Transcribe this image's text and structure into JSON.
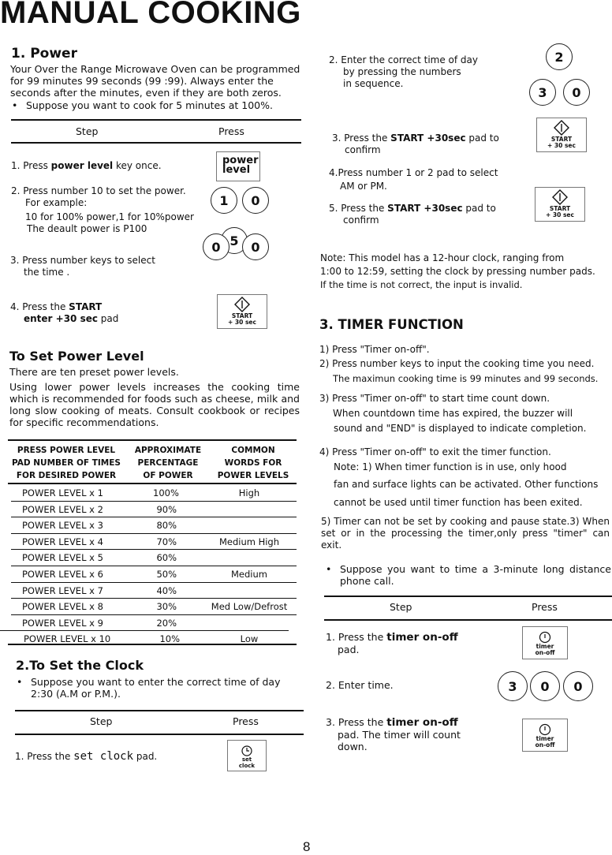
{
  "page_title": "MANUAL COOKING",
  "page_number": "8",
  "power": {
    "heading": "1. Power",
    "intro": "Your Over the Range Microwave Oven can be programmed for 99 minutes 99 seconds (99 :99). Always enter the seconds after the minutes, even if they are both zeros.",
    "bullet": "Suppose you want to cook for 5 minutes at 100%.",
    "table_headers": {
      "step": "Step",
      "press": "Press"
    },
    "steps": [
      {
        "pre": "1. Press ",
        "bold": "power level",
        "post": " key once."
      },
      {
        "line1": "2. Press number 10 to set the power.",
        "line2": "For example:",
        "line3": "10 for 100% power,1 for 10%power",
        "line4": "The deault power is P100"
      },
      {
        "line1": "3. Press number keys to select",
        "line2": "the time ."
      },
      {
        "pre": "4. Press the ",
        "bold1": "START",
        "bold2": "enter +30 sec",
        "post": " pad"
      }
    ],
    "keys": {
      "power_level": [
        "power",
        "level"
      ],
      "step2": [
        "1",
        "0"
      ],
      "step3": [
        "5",
        "0",
        "0"
      ],
      "start_label": [
        "START",
        "+ 30 sec"
      ]
    }
  },
  "power_level": {
    "heading": "To Set Power Level",
    "p1": "There are ten preset power levels.",
    "p2": "Using lower power levels increases the cooking time which is recommended for foods such as cheese, milk and long slow cooking of meats. Consult cookbook or recipes for specific recommendations.",
    "headers": [
      [
        "PRESS POWER LEVEL",
        "PAD NUMBER OF TIMES",
        "FOR DESIRED POWER"
      ],
      [
        "APPROXIMATE",
        "PERCENTAGE",
        "OF POWER"
      ],
      [
        "COMMON",
        "WORDS FOR",
        "POWER LEVELS"
      ]
    ],
    "rows": [
      {
        "press": "POWER LEVEL x 1",
        "percent": "100%",
        "words": "High"
      },
      {
        "press": "POWER LEVEL x 2",
        "percent": "90%",
        "words": ""
      },
      {
        "press": "POWER LEVEL x 3",
        "percent": "80%",
        "words": ""
      },
      {
        "press": "POWER LEVEL x 4",
        "percent": "70%",
        "words": "Medium High"
      },
      {
        "press": "POWER LEVEL x 5",
        "percent": "60%",
        "words": ""
      },
      {
        "press": "POWER LEVEL x 6",
        "percent": "50%",
        "words": "Medium"
      },
      {
        "press": "POWER LEVEL x 7",
        "percent": "40%",
        "words": ""
      },
      {
        "press": "POWER LEVEL x 8",
        "percent": "30%",
        "words": "Med Low/Defrost"
      },
      {
        "press": "POWER LEVEL x 9",
        "percent": "20%",
        "words": ""
      },
      {
        "press": "POWER LEVEL x 10",
        "percent": "10%",
        "words": "Low"
      }
    ]
  },
  "clock": {
    "heading": "2.To Set the Clock",
    "bullet": "Suppose you want to enter the correct time of day 2:30 (A.M or P.M.).",
    "table_headers": {
      "step": "Step",
      "press": "Press"
    },
    "step1": {
      "pre": "1. Press the ",
      "mid": "set clock",
      "post": "  pad."
    },
    "step2": {
      "line1": "2. Enter the correct time of day",
      "line2": "by pressing the numbers",
      "line3": "in sequence."
    },
    "step3": {
      "pre": "3. Press the ",
      "bold": "START +30sec",
      "post": " pad to",
      "line2": "confirm"
    },
    "step4": {
      "line1": "4.Press number 1 or 2 pad  to select",
      "line2": "AM or PM."
    },
    "step5": {
      "pre": "5. Press the ",
      "bold": "START +30sec",
      "post": " pad to",
      "line2": "confirm"
    },
    "keys": {
      "set_clock": [
        "set",
        "clock"
      ],
      "time": [
        "2",
        "3",
        "0"
      ],
      "start_label": [
        "START",
        "+ 30 sec"
      ]
    },
    "note": [
      "Note: This model has a 12-hour clock, ranging from",
      "1:00 to 12:59, setting the clock by pressing number pads.",
      " If the time is not correct, the input is invalid."
    ]
  },
  "timer": {
    "heading": "3. TIMER FUNCTION",
    "lines": [
      "1) Press  \"Timer on-off\".",
      "2) Press number keys to input the cooking time you need.",
      "The maximun cooking time is 99 minutes and 99 seconds.",
      "3) Press  \"Timer on-off\"  to start time count down.",
      "When countdown time has expired, the buzzer will",
      "sound and \"END\"   is displayed to indicate completion.",
      "4) Press  \"Timer on-off\"  to exit the timer function.",
      "Note:  1) When timer function is in use, only hood",
      "fan and surface lights can be activated. Other functions",
      "cannot be used until timer function has been exited.",
      "5) Timer can not be set by cooking and pause state.3) When set or in the processing the timer,only press \"timer\" can exit."
    ],
    "bullet": "Suppose you want to time a 3-minute long distance phone call.",
    "table_headers": {
      "step": "Step",
      "press": "Press"
    },
    "step1": {
      "pre": "1. Press the ",
      "bold": "timer on-off",
      "line2": "pad."
    },
    "step2": "2. Enter time.",
    "step3": {
      "pre": "3. Press the ",
      "bold": "timer on-off",
      "line2": "pad. The timer will count",
      "line3": "down."
    },
    "keys": {
      "timer_label": [
        "timer",
        "on-off"
      ],
      "time": [
        "3",
        "0",
        "0"
      ]
    }
  }
}
